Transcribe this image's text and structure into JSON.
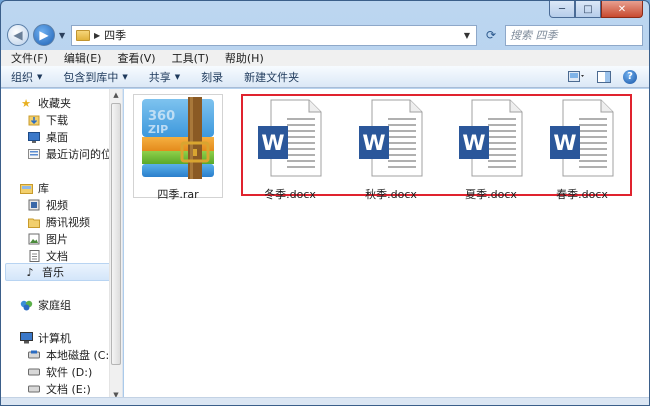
{
  "window": {
    "title": "四季"
  },
  "caption": {
    "minimize": "─",
    "maximize": "□",
    "close": "✕"
  },
  "address": {
    "breadcrumb": "四季",
    "search_placeholder": "搜索 四季"
  },
  "menu": [
    "文件(F)",
    "编辑(E)",
    "查看(V)",
    "工具(T)",
    "帮助(H)"
  ],
  "toolbar": {
    "organize": "组织",
    "include_library": "包含到库中",
    "share": "共享",
    "burn": "刻录",
    "new_folder": "新建文件夹"
  },
  "nav": {
    "favorites": {
      "label": "收藏夹",
      "items": [
        "下载",
        "桌面",
        "最近访问的位置"
      ]
    },
    "libraries": {
      "label": "库",
      "items": [
        "视频",
        "腾讯视频",
        "图片",
        "文档",
        "音乐"
      ]
    },
    "homegroup": "家庭组",
    "computer": {
      "label": "计算机",
      "items": [
        "本地磁盘 (C:)",
        "软件 (D:)",
        "文档 (E:)"
      ]
    }
  },
  "files": [
    {
      "name": "四季.rar",
      "type": "archive"
    },
    {
      "name": "冬季.docx",
      "type": "word"
    },
    {
      "name": "秋季.docx",
      "type": "word"
    },
    {
      "name": "夏季.docx",
      "type": "word"
    },
    {
      "name": "春季.docx",
      "type": "word"
    }
  ],
  "archive_icon_text": "360 ZIP",
  "colors": {
    "accent": "#1f5bb0",
    "highlight": "#e0232e",
    "word_blue": "#2b579a"
  }
}
